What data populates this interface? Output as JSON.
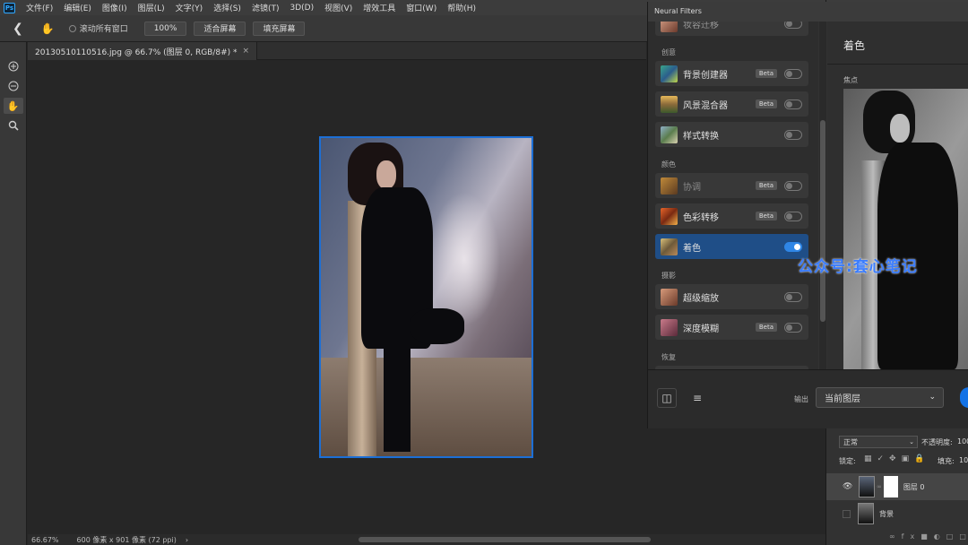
{
  "app": {
    "logo": "Ps"
  },
  "menu": [
    "文件(F)",
    "编辑(E)",
    "图像(I)",
    "图层(L)",
    "文字(Y)",
    "选择(S)",
    "滤镜(T)",
    "3D(D)",
    "视图(V)",
    "增效工具",
    "窗口(W)",
    "帮助(H)"
  ],
  "options": {
    "back_icon": "chevron-left-icon",
    "hand_icon": "hand-icon",
    "scroll_all_label": "滚动所有窗口",
    "zoom_value": "100%",
    "fit_screen_label": "适合屏幕",
    "fill_screen_label": "填充屏幕"
  },
  "document": {
    "tab_title": "20130510110516.jpg @ 66.7% (图层 0, RGB/8#) *",
    "close": "×"
  },
  "tools": [
    "zoom-in-icon",
    "zoom-out-icon",
    "hand-icon",
    "magnifier-icon"
  ],
  "status": {
    "zoom": "66.67%",
    "info": "600 像素 x 901 像素 (72 ppi)",
    "arrow": "›"
  },
  "neural_filters": {
    "title": "Neural Filters",
    "top_partial": "妆容迁移",
    "categories": {
      "creative": "创意",
      "color": "颜色",
      "photography": "摄影",
      "restore": "恢复"
    },
    "filters": [
      {
        "label": "背景创建器",
        "beta": "Beta",
        "on": false
      },
      {
        "label": "风景混合器",
        "beta": "Beta",
        "on": false
      },
      {
        "label": "样式转换",
        "beta": "",
        "on": false
      },
      {
        "label": "协调",
        "beta": "Beta",
        "on": false
      },
      {
        "label": "色彩转移",
        "beta": "Beta",
        "on": false
      },
      {
        "label": "着色",
        "beta": "",
        "on": true
      },
      {
        "label": "超级缩放",
        "beta": "",
        "on": false
      },
      {
        "label": "深度模糊",
        "beta": "Beta",
        "on": false
      }
    ],
    "detail_title": "着色",
    "focus_label": "焦点",
    "output_label": "输出",
    "output_value": "当前图层"
  },
  "watermark": "公众号:套心笔记",
  "layers": {
    "blend_mode": "正常",
    "opacity_label": "不透明度:",
    "opacity_value": "100",
    "lock_label": "锁定:",
    "fill_label": "填充:",
    "fill_value": "10",
    "items": [
      {
        "name": "图层 0",
        "visible": true
      },
      {
        "name": "背景",
        "visible": false
      }
    ]
  },
  "colors": {
    "accent": "#1473e6",
    "selected_row": "#1f4e87",
    "canvas_border": "#1c6fd6"
  }
}
